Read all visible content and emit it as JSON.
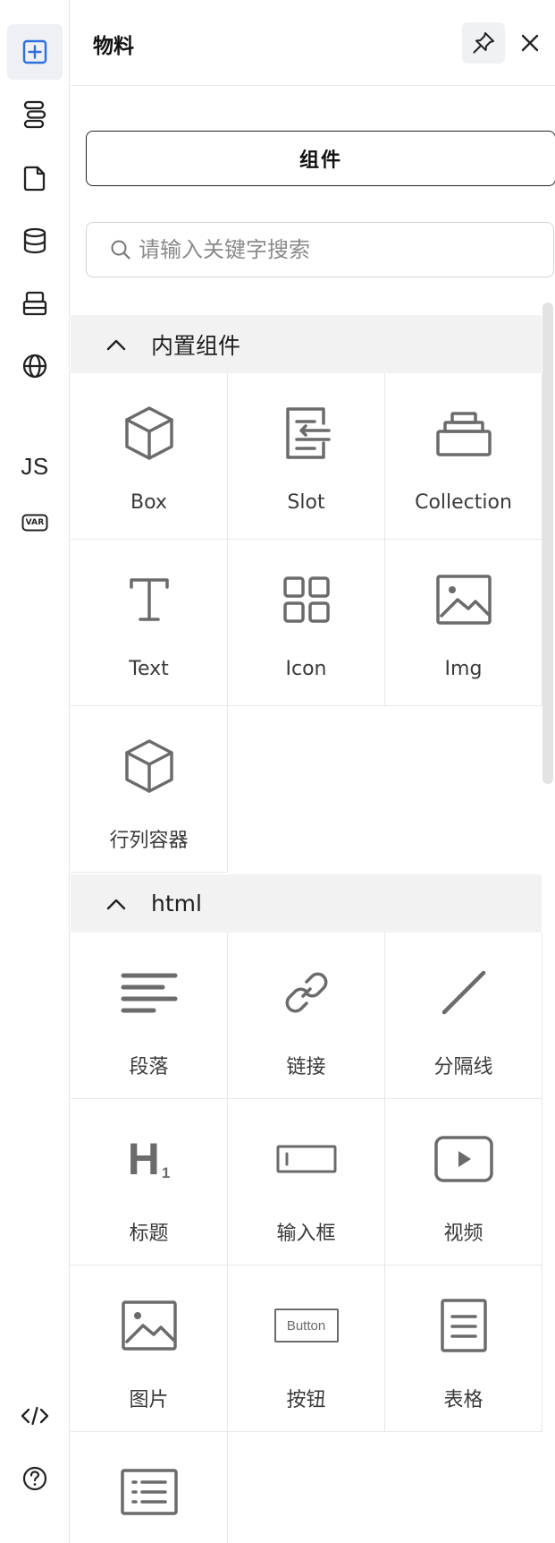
{
  "panel": {
    "title": "物料",
    "tab_label": "组件",
    "search_placeholder": "请输入关键字搜索"
  },
  "rail": {
    "js_label": "JS",
    "var_label": "VAR",
    "items": [
      "add-component-icon",
      "outline-icon",
      "page-icon",
      "database-icon",
      "block-icon",
      "globe-icon",
      "js-icon",
      "variable-icon",
      "code-icon",
      "help-icon"
    ]
  },
  "sections": [
    {
      "title": "内置组件",
      "items": [
        {
          "label": "Box",
          "icon": "cube-icon"
        },
        {
          "label": "Slot",
          "icon": "slot-icon"
        },
        {
          "label": "Collection",
          "icon": "collection-icon"
        },
        {
          "label": "Text",
          "icon": "text-icon"
        },
        {
          "label": "Icon",
          "icon": "grid-icon"
        },
        {
          "label": "Img",
          "icon": "image-icon"
        },
        {
          "label": "行列容器",
          "icon": "cube-icon"
        }
      ]
    },
    {
      "title": "html",
      "items": [
        {
          "label": "段落",
          "icon": "paragraph-icon"
        },
        {
          "label": "链接",
          "icon": "link-icon"
        },
        {
          "label": "分隔线",
          "icon": "divider-icon"
        },
        {
          "label": "标题",
          "icon": "heading-icon",
          "glyph": "H",
          "sub": "1"
        },
        {
          "label": "输入框",
          "icon": "input-icon"
        },
        {
          "label": "视频",
          "icon": "video-icon"
        },
        {
          "label": "图片",
          "icon": "image-icon"
        },
        {
          "label": "按钮",
          "icon": "button-icon",
          "glyph": "Button"
        },
        {
          "label": "表格",
          "icon": "table-icon"
        },
        {
          "label": "",
          "icon": "list-icon"
        }
      ]
    }
  ]
}
